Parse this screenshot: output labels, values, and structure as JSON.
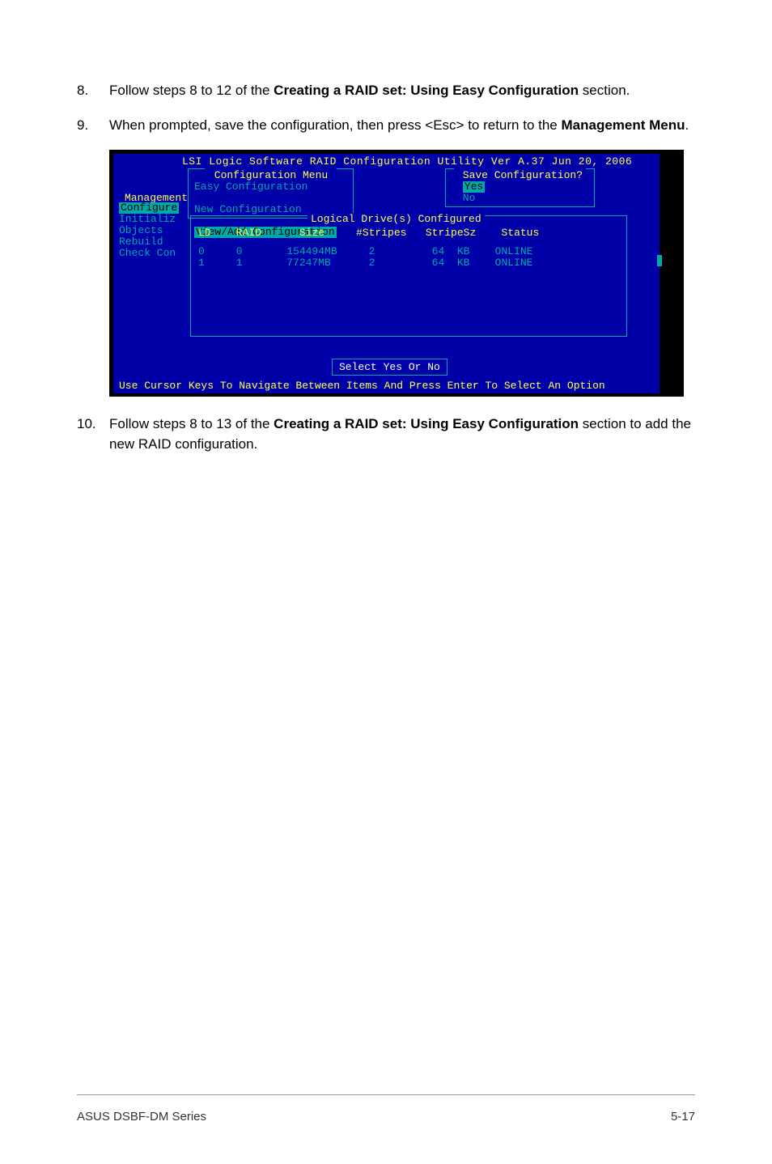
{
  "steps": {
    "s8": {
      "num": "8.",
      "pre": "Follow steps 8 to 12 of the ",
      "bold": "Creating a RAID set: Using Easy Configuration",
      "post": " section."
    },
    "s9": {
      "num": "9.",
      "pre": "When prompted, save the configuration, then press <Esc> to return to the ",
      "bold": "Management Menu",
      "post": "."
    },
    "s10": {
      "num": "10.",
      "pre": "Follow steps 8 to 13 of the ",
      "bold": "Creating a RAID set: Using Easy Configuration",
      "post": " section to add the new RAID configuration."
    }
  },
  "bios": {
    "title": "LSI Logic Software RAID Configuration Utility Ver A.37 Jun 20, 2006",
    "management_label": "Management",
    "sidebar": [
      "Configure",
      "Initializ",
      "Objects",
      "Rebuild",
      "Check Con"
    ],
    "cfg_menu": {
      "title": "Configuration Menu",
      "items": [
        "Easy Configuration",
        "New Configuration",
        "View/Add Configuration"
      ]
    },
    "save": {
      "title": "Save Configuration?",
      "yes": "Yes",
      "no": "No"
    },
    "ld_title": "Logical Drive(s) Configured",
    "ld_head": "LD    RAID      Size     #Stripes   StripeSz    Status",
    "ld_rows": "0     0       154494MB     2         64  KB    ONLINE\n1     1       77247MB      2         64  KB    ONLINE",
    "prompt": "Select Yes Or No",
    "hint": "Use Cursor Keys To Navigate Between Items And Press Enter To Select An Option"
  },
  "footer": {
    "left": "ASUS DSBF-DM Series",
    "right": "5-17"
  },
  "chart_data": {
    "type": "table",
    "title": "Logical Drive(s) Configured",
    "columns": [
      "LD",
      "RAID",
      "Size",
      "#Stripes",
      "StripeSz",
      "Status"
    ],
    "rows": [
      {
        "LD": 0,
        "RAID": 0,
        "Size": "154494MB",
        "#Stripes": 2,
        "StripeSz": "64 KB",
        "Status": "ONLINE"
      },
      {
        "LD": 1,
        "RAID": 1,
        "Size": "77247MB",
        "#Stripes": 2,
        "StripeSz": "64 KB",
        "Status": "ONLINE"
      }
    ]
  }
}
